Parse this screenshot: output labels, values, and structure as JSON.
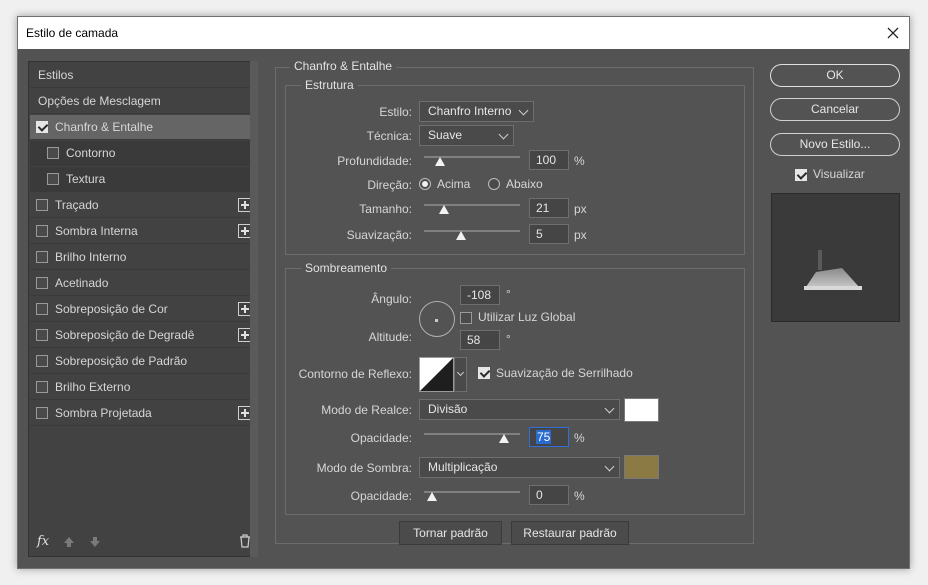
{
  "window": {
    "title": "Estilo de camada"
  },
  "sidebar": {
    "items": [
      {
        "label": "Estilos",
        "kind": "header"
      },
      {
        "label": "Opções de Mesclagem",
        "kind": "header"
      },
      {
        "label": "Chanfro & Entalhe",
        "checked": true,
        "selected": true,
        "plus": false
      },
      {
        "label": "Contorno",
        "checked": false,
        "sub": true,
        "plus": false
      },
      {
        "label": "Textura",
        "checked": false,
        "sub": true,
        "plus": false
      },
      {
        "label": "Traçado",
        "checked": false,
        "plus": true
      },
      {
        "label": "Sombra Interna",
        "checked": false,
        "plus": true
      },
      {
        "label": "Brilho Interno",
        "checked": false,
        "plus": false
      },
      {
        "label": "Acetinado",
        "checked": false,
        "plus": false
      },
      {
        "label": "Sobreposição de Cor",
        "checked": false,
        "plus": true
      },
      {
        "label": "Sobreposição de Degradê",
        "checked": false,
        "plus": true
      },
      {
        "label": "Sobreposição de Padrão",
        "checked": false,
        "plus": false
      },
      {
        "label": "Brilho Externo",
        "checked": false,
        "plus": false
      },
      {
        "label": "Sombra Projetada",
        "checked": false,
        "plus": true
      }
    ],
    "footer": {
      "fx": "fx"
    }
  },
  "bevel": {
    "group_title": "Chanfro & Entalhe",
    "structure": {
      "title": "Estrutura",
      "style_label": "Estilo:",
      "style_value": "Chanfro Interno",
      "technique_label": "Técnica:",
      "technique_value": "Suave",
      "depth_label": "Profundidade:",
      "depth_value": "100",
      "depth_unit": "%",
      "depth_level": 0.08,
      "direction_label": "Direção:",
      "dir_up": "Acima",
      "dir_down": "Abaixo",
      "direction_selected": "Acima",
      "size_label": "Tamanho:",
      "size_value": "21",
      "size_unit": "px",
      "size_level": 0.12,
      "soften_label": "Suavização:",
      "soften_value": "5",
      "soften_unit": "px",
      "soften_level": 0.3
    },
    "shading": {
      "title": "Sombreamento",
      "angle_label": "Ângulo:",
      "angle_value": "-108",
      "angle_unit": "°",
      "global_light_label": "Utilizar Luz Global",
      "global_light_checked": false,
      "altitude_label": "Altitude:",
      "altitude_value": "58",
      "altitude_unit": "°",
      "gloss_label": "Contorno de Reflexo:",
      "antialias_label": "Suavização de Serrilhado",
      "antialias_checked": true,
      "highlight_mode_label": "Modo de Realce:",
      "highlight_mode_value": "Divisão",
      "highlight_color": "#ffffff",
      "highlight_opacity_label": "Opacidade:",
      "highlight_opacity_value": "75",
      "highlight_opacity_unit": "%",
      "highlight_opacity_level": 0.75,
      "shadow_mode_label": "Modo de Sombra:",
      "shadow_mode_value": "Multiplicação",
      "shadow_color": "#8c7a45",
      "shadow_opacity_label": "Opacidade:",
      "shadow_opacity_value": "0",
      "shadow_opacity_unit": "%",
      "shadow_opacity_level": 0.0
    },
    "make_default": "Tornar padrão",
    "reset_default": "Restaurar padrão"
  },
  "right": {
    "ok": "OK",
    "cancel": "Cancelar",
    "new_style": "Novo Estilo...",
    "preview_label": "Visualizar",
    "preview_checked": true
  }
}
